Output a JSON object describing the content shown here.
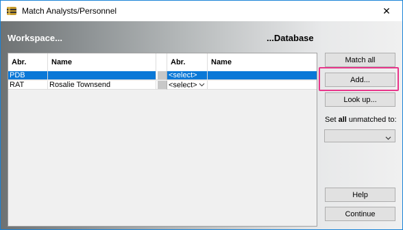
{
  "window": {
    "title": "Match Analysts/Personnel",
    "close_glyph": "✕",
    "icon": "barrel-icon"
  },
  "headers": {
    "workspace": "Workspace...",
    "database": "...Database"
  },
  "grid": {
    "columns": [
      "Abr.",
      "Name",
      "Abr.",
      "Name"
    ],
    "rows": [
      {
        "ws_abbr": "PDB",
        "ws_name": "",
        "db_abbr": "<select>",
        "db_name": "",
        "selected": true
      },
      {
        "ws_abbr": "RAT",
        "ws_name": "Rosalie Townsend",
        "db_abbr": "<select>",
        "db_name": "",
        "selected": false
      }
    ]
  },
  "buttons": {
    "match_all": "Match all",
    "add": "Add...",
    "look_up": "Look up...",
    "help": "Help",
    "continue": "Continue"
  },
  "unmatched": {
    "prefix": "Set ",
    "bold": "all",
    "suffix": " unmatched to:",
    "value": ""
  },
  "colors": {
    "selection": "#0a78d7",
    "highlight": "#e8358a",
    "window_border": "#1883d7"
  }
}
